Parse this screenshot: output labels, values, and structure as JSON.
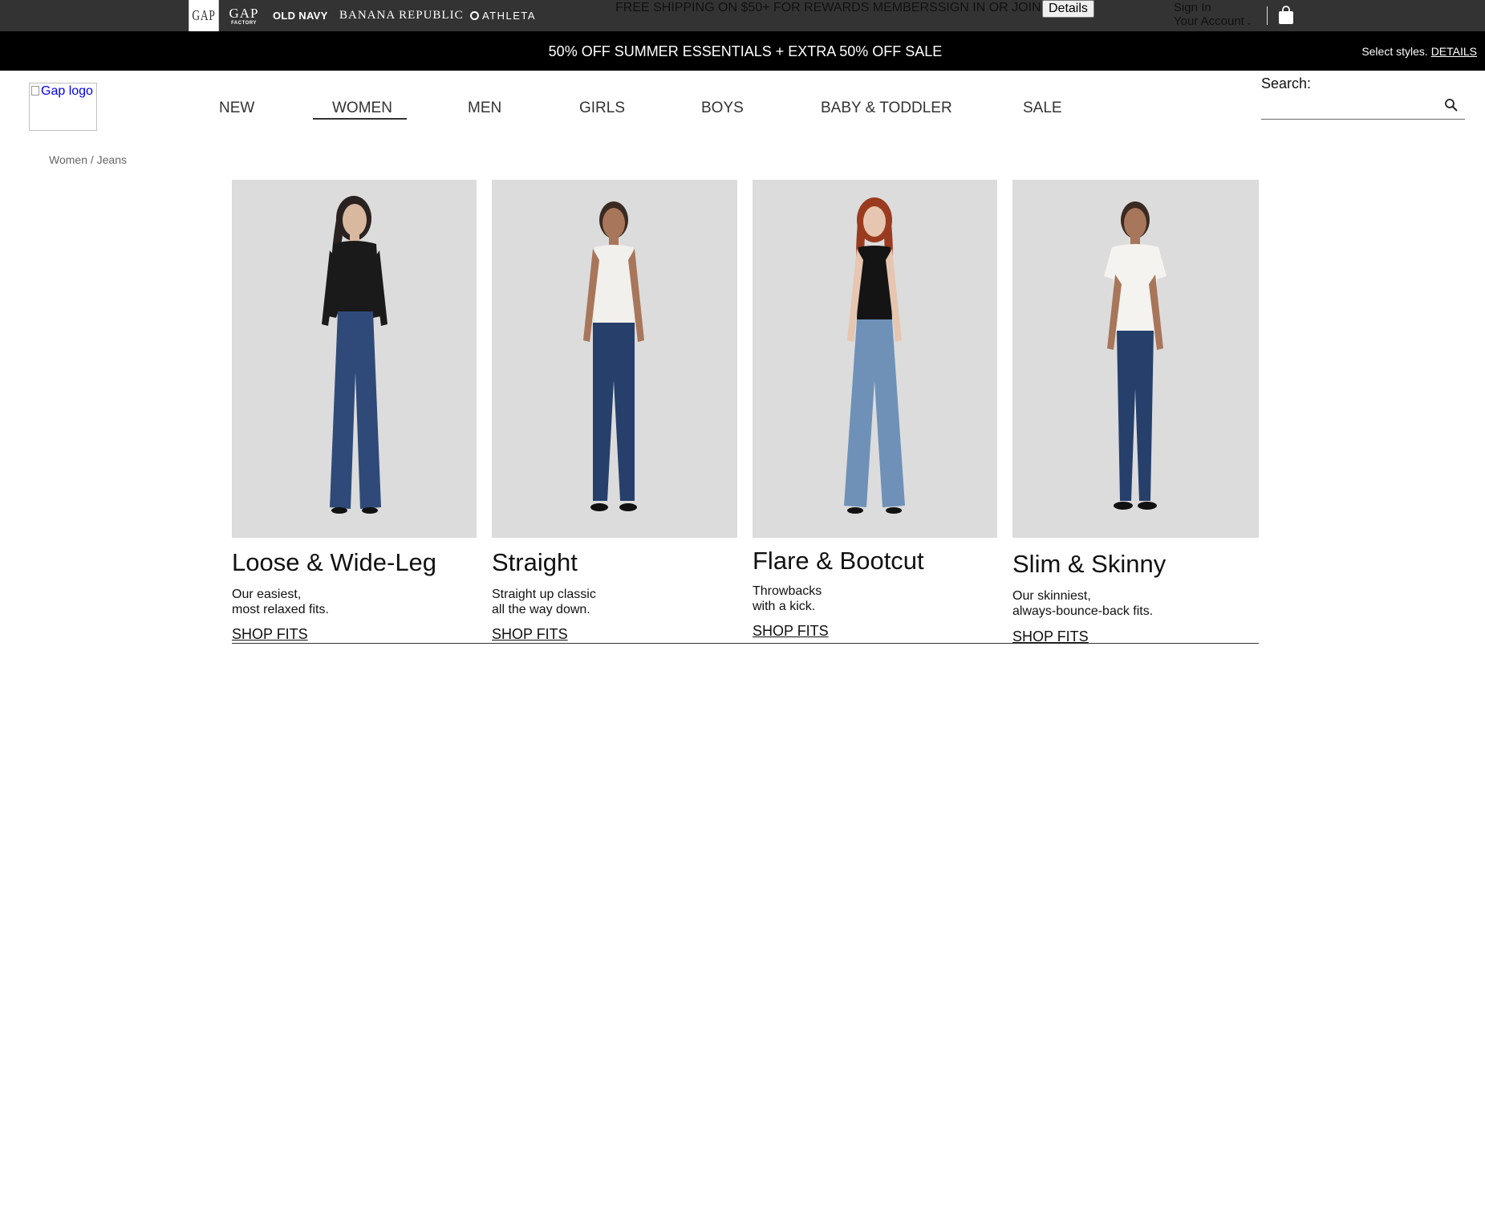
{
  "brands": {
    "gap": "GAP",
    "gap_factory_top": "GAP",
    "gap_factory_bottom": "FACTORY",
    "old_navy": "OLD NAVY",
    "banana_republic": "BANANA REPUBLIC",
    "athleta": "ATHLETA"
  },
  "utility": {
    "promo": "FREE SHIPPING ON $50+ FOR REWARDS MEMBERSSIGN IN OR JOIN",
    "details_button": "Details",
    "sign_in": "Sign In",
    "your_account": "Your Account"
  },
  "promo_bar": {
    "headline": "50% OFF SUMMER ESSENTIALS + EXTRA 50% OFF SALE",
    "select_styles": "Select styles.",
    "details_link": "DETAILS"
  },
  "header": {
    "logo_alt": "Gap logo",
    "nav": [
      "NEW",
      "WOMEN",
      "MEN",
      "GIRLS",
      "BOYS",
      "BABY & TODDLER",
      "SALE"
    ],
    "active_nav": "WOMEN",
    "search_label": "Search:"
  },
  "breadcrumb": "Women / Jeans",
  "cards": [
    {
      "title": "Loose & Wide-Leg",
      "desc_line1": "Our easiest,",
      "desc_line2": "most relaxed fits.",
      "link": "SHOP FITS"
    },
    {
      "title": "Straight",
      "desc_line1": "Straight up classic",
      "desc_line2": "all the way down.",
      "link": "SHOP FITS"
    },
    {
      "title": "Flare & Bootcut",
      "desc_line1": "Throwbacks",
      "desc_line2": "with a kick.",
      "link": "SHOP FITS"
    },
    {
      "title": "Slim & Skinny",
      "desc_line1": "Our skinniest,",
      "desc_line2": "always-bounce-back fits.",
      "link": "SHOP FITS"
    }
  ],
  "colors": {
    "utility_bar": "#333333",
    "promo_bar": "#000000",
    "photo_background": "#dcdcdc",
    "denim_dark": "#2f4a78",
    "denim_light": "#6f91b8"
  }
}
